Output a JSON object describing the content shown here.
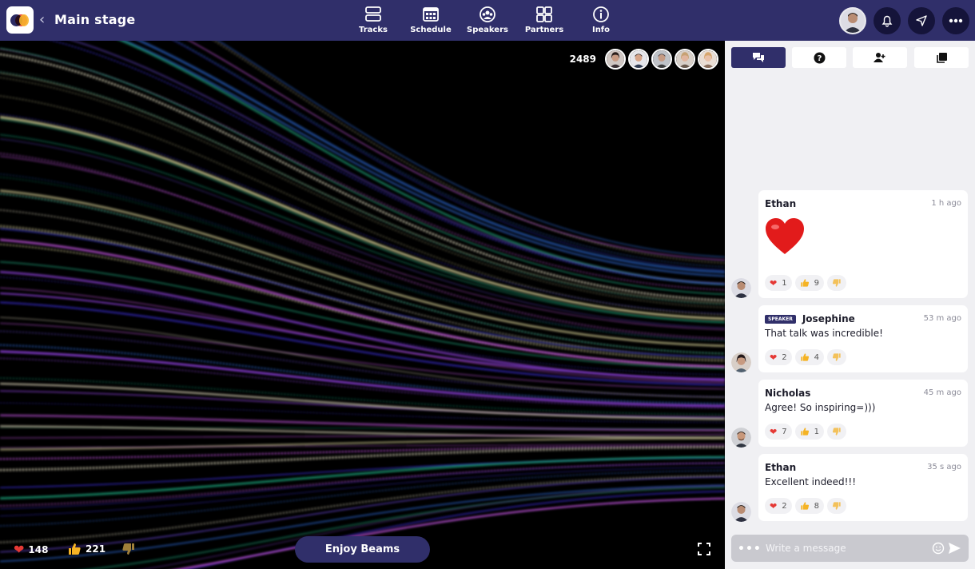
{
  "header": {
    "title": "Main stage",
    "nav": [
      {
        "label": "Tracks",
        "icon": "tracks-icon"
      },
      {
        "label": "Schedule",
        "icon": "calendar-icon"
      },
      {
        "label": "Speakers",
        "icon": "speakers-icon"
      },
      {
        "label": "Partners",
        "icon": "grid-icon"
      },
      {
        "label": "Info",
        "icon": "info-icon"
      }
    ],
    "right_icons": [
      "avatar",
      "bell-icon",
      "send-icon",
      "more-icon"
    ]
  },
  "stage": {
    "viewer_count": "2489",
    "reactions": {
      "hearts": "148",
      "likes": "221"
    },
    "session_title": "Enjoy Beams"
  },
  "chat": {
    "tabs": [
      "chat-icon",
      "question-icon",
      "people-icon",
      "copy-icon"
    ],
    "messages": [
      {
        "name": "Ethan",
        "time": "1 h ago",
        "text": "",
        "emoji_only": true,
        "speaker": false,
        "hearts": "1",
        "likes": "9"
      },
      {
        "name": "Josephine",
        "time": "53 m ago",
        "text": "That talk was incredible!",
        "speaker": true,
        "badge": "SPEAKER",
        "hearts": "2",
        "likes": "4"
      },
      {
        "name": "Nicholas",
        "time": "45 m ago",
        "text": "Agree! So inspiring=)))",
        "speaker": false,
        "hearts": "7",
        "likes": "1"
      },
      {
        "name": "Ethan",
        "time": "35 s ago",
        "text": "Excellent indeed!!!",
        "speaker": false,
        "hearts": "2",
        "likes": "8"
      }
    ],
    "composer_placeholder": "Write a message"
  },
  "colors": {
    "brand": "#302f6a",
    "heart": "#e53935",
    "like": "#f5b324"
  }
}
